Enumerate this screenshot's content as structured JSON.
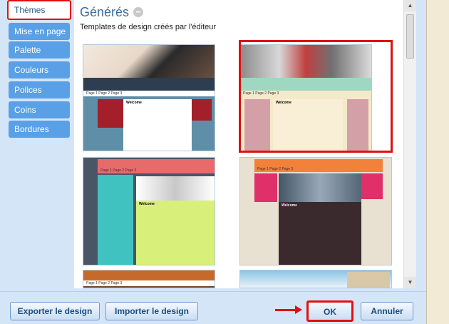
{
  "sidebar": {
    "items": [
      {
        "label": "Thèmes"
      },
      {
        "label": "Mise en page"
      },
      {
        "label": "Palette"
      },
      {
        "label": "Couleurs"
      },
      {
        "label": "Polices"
      },
      {
        "label": "Coins"
      },
      {
        "label": "Bordures"
      }
    ],
    "active_index": 0
  },
  "main": {
    "title": "Générés",
    "collapse_symbol": "−",
    "subtitle": "Templates de design créés par l'éditeur",
    "template_nav": "Page 1   Page 2   Page 3",
    "template_heading": "Welcome",
    "templates": [
      {
        "name": "fur-model-dark",
        "hero": "#2c3e50",
        "body": "#5f8fa8",
        "side": "#a3202a",
        "selected": false
      },
      {
        "name": "fashion-store-pastel",
        "hero": "#7a7a7a",
        "body": "#f4eacb",
        "side": "#d4a0a8",
        "selected": true
      },
      {
        "name": "coral-lime",
        "hero": "#e86b6b",
        "body": "#d8f07a",
        "side": "#3fc2c0",
        "selected": false
      },
      {
        "name": "mall-dark-pink",
        "hero": "#f2823a",
        "body": "#3a2a2e",
        "side": "#e0306a",
        "selected": false
      },
      {
        "name": "brown-orange",
        "hero": "#c56a2a",
        "body": "#6b4a2a",
        "side": "#c56a2a",
        "selected": false
      },
      {
        "name": "seaside-villa",
        "hero": "#7ab8d8",
        "body": "#e8f2f8",
        "side": "#4a88b8",
        "selected": false
      }
    ]
  },
  "footer": {
    "export_label": "Exporter le design",
    "import_label": "Importer le design",
    "ok_label": "OK",
    "cancel_label": "Annuler"
  },
  "colors": {
    "accent_red": "#e01010",
    "sidebar_blue": "#5aa0e6",
    "title_blue": "#3a6ea5"
  }
}
